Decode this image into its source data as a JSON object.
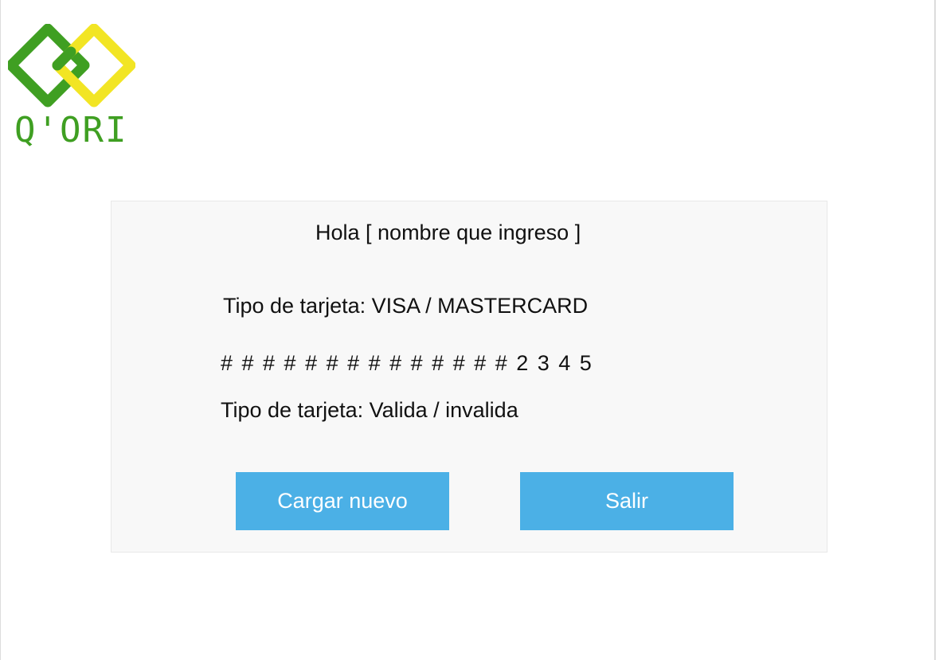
{
  "brand": {
    "logo_text": "Q'ORI",
    "colors": {
      "green": "#3f9f22",
      "yellow": "#f2e524"
    }
  },
  "card": {
    "greeting": "Hola [ nombre que ingreso ]",
    "type_line": "Tipo de tarjeta:  VISA / MASTERCARD",
    "number": "# # # # # # # # # # # # # # 2 3 4 5",
    "validity_line": "Tipo de tarjeta:  Valida / invalida"
  },
  "buttons": {
    "load_new": "Cargar nuevo",
    "exit": "Salir",
    "color": "#4bb0e6"
  }
}
